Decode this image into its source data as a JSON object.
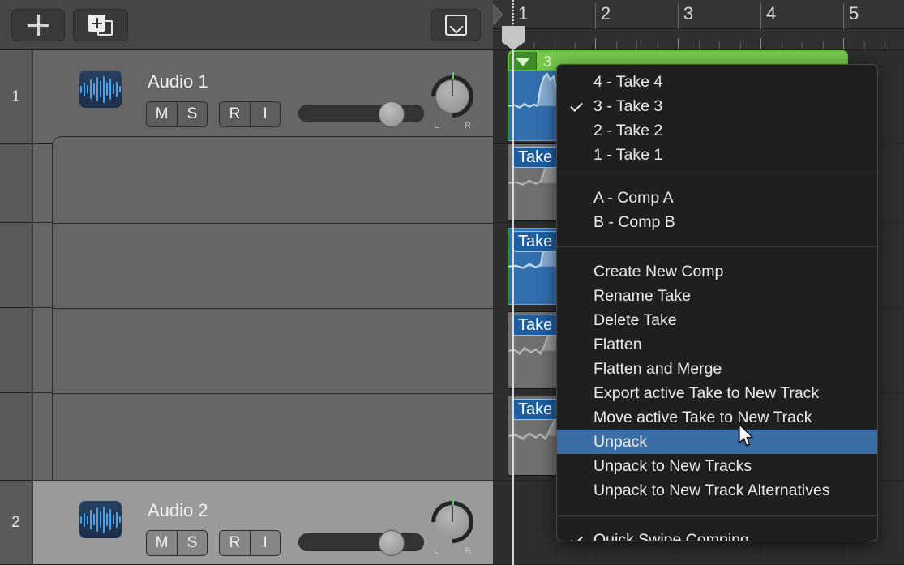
{
  "toolbar": {
    "add_track_label": "+",
    "add_track_icon": "plus-icon",
    "duplicate_track_icon": "add-duplicate-track-icon",
    "collapse_icon": "chevron-down-box-icon"
  },
  "ruler": {
    "bars": [
      "1",
      "2",
      "3",
      "4",
      "5"
    ]
  },
  "tracks": [
    {
      "number": "1",
      "name": "Audio 1",
      "mute": "M",
      "solo": "S",
      "record": "R",
      "input": "I",
      "pan_left": "L",
      "pan_right": "R",
      "selected": false
    },
    {
      "number": "2",
      "name": "Audio 2",
      "mute": "M",
      "solo": "S",
      "record": "R",
      "input": "I",
      "pan_left": "L",
      "pan_right": "R",
      "selected": true
    }
  ],
  "region": {
    "take_number": "3",
    "disclosure_icon": "triangle-down-icon",
    "color": "#c9e8ad",
    "header_color": "#77c94e"
  },
  "take_lanes": [
    {
      "label": "",
      "state": "active"
    },
    {
      "label": "Take",
      "state": "inactive"
    },
    {
      "label": "Take",
      "state": "active"
    },
    {
      "label": "Take",
      "state": "inactive"
    },
    {
      "label": "Take",
      "state": "inactive"
    }
  ],
  "menu": {
    "accent_color": "#3a6ea5",
    "groups": [
      {
        "items": [
          {
            "label": "4 - Take 4",
            "checked": false,
            "selected": false
          },
          {
            "label": "3 - Take 3",
            "checked": true,
            "selected": false
          },
          {
            "label": "2 - Take 2",
            "checked": false,
            "selected": false
          },
          {
            "label": "1 - Take 1",
            "checked": false,
            "selected": false
          }
        ]
      },
      {
        "items": [
          {
            "label": "A - Comp A",
            "checked": false,
            "selected": false
          },
          {
            "label": "B - Comp B",
            "checked": false,
            "selected": false
          }
        ]
      },
      {
        "items": [
          {
            "label": "Create New Comp",
            "checked": false,
            "selected": false
          },
          {
            "label": "Rename Take",
            "checked": false,
            "selected": false
          },
          {
            "label": "Delete Take",
            "checked": false,
            "selected": false
          },
          {
            "label": "Flatten",
            "checked": false,
            "selected": false
          },
          {
            "label": "Flatten and Merge",
            "checked": false,
            "selected": false
          },
          {
            "label": "Export active Take to New Track",
            "checked": false,
            "selected": false
          },
          {
            "label": "Move active Take to New Track",
            "checked": false,
            "selected": false
          },
          {
            "label": "Unpack",
            "checked": false,
            "selected": true
          },
          {
            "label": "Unpack to New Tracks",
            "checked": false,
            "selected": false
          },
          {
            "label": "Unpack to New Track Alternatives",
            "checked": false,
            "selected": false
          }
        ]
      },
      {
        "items": [
          {
            "label": "Quick Swipe Comping",
            "checked": true,
            "selected": false
          }
        ]
      }
    ]
  },
  "cursor": {
    "icon": "mouse-pointer-icon"
  }
}
